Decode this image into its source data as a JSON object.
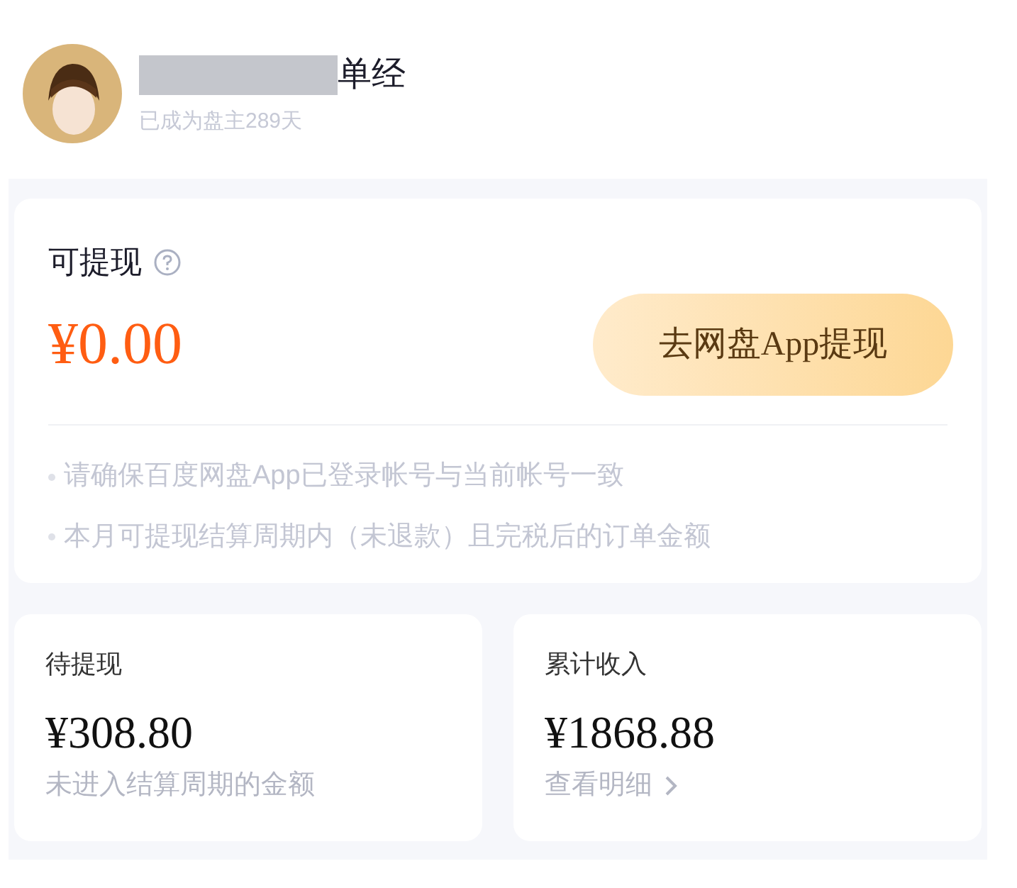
{
  "profile": {
    "name": "单经",
    "subtitle": "已成为盘主289天"
  },
  "withdrawable": {
    "title": "可提现",
    "amount": "¥0.00",
    "button": "去网盘App提现",
    "notes": [
      "请确保百度网盘App已登录帐号与当前帐号一致",
      "本月可提现结算周期内（未退款）且完税后的订单金额"
    ]
  },
  "stats": [
    {
      "kind": "plain",
      "title": "待提现",
      "amount": "¥308.80",
      "caption": "未进入结算周期的金额"
    },
    {
      "kind": "link",
      "title": "累计收入",
      "amount": "¥1868.88",
      "caption": "查看明细"
    }
  ]
}
